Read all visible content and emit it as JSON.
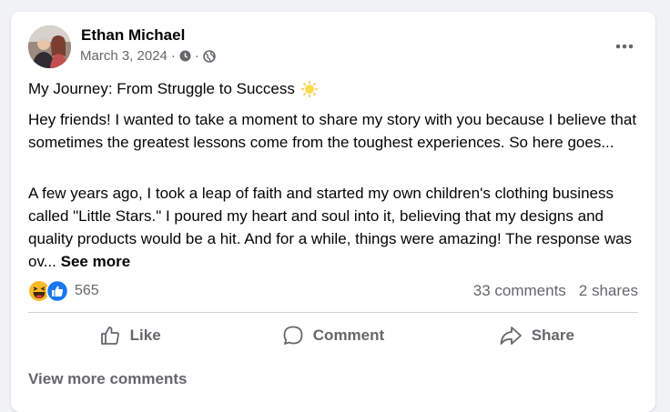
{
  "post": {
    "author": "Ethan Michael",
    "date": "March 3, 2024",
    "meta_separator": "·",
    "privacy_icon": "globe-icon",
    "title": "My Journey: From Struggle to Success",
    "title_emoji": "sun-emoji",
    "paragraph_1": "Hey friends! I wanted to take a moment to share my story with you because I believe that sometimes the greatest lessons come from the toughest experiences. So here goes...",
    "paragraph_2": "A few years ago, I took a leap of faith and started my own children's clothing business called \"Little Stars.\" I poured my heart and soul into it, believing that my designs and quality products would be a hit. And for a while, things were amazing! The response was ov...",
    "see_more": "See more"
  },
  "reactions": {
    "types": [
      "haha",
      "like"
    ],
    "count": "565",
    "comments": "33 comments",
    "shares": "2 shares"
  },
  "actions": {
    "like": "Like",
    "comment": "Comment",
    "share": "Share"
  },
  "footer": {
    "view_more": "View more comments"
  },
  "colors": {
    "like_blue": "#1877f2",
    "haha_yellow": "#f7b928",
    "secondary_text": "#65676b"
  }
}
